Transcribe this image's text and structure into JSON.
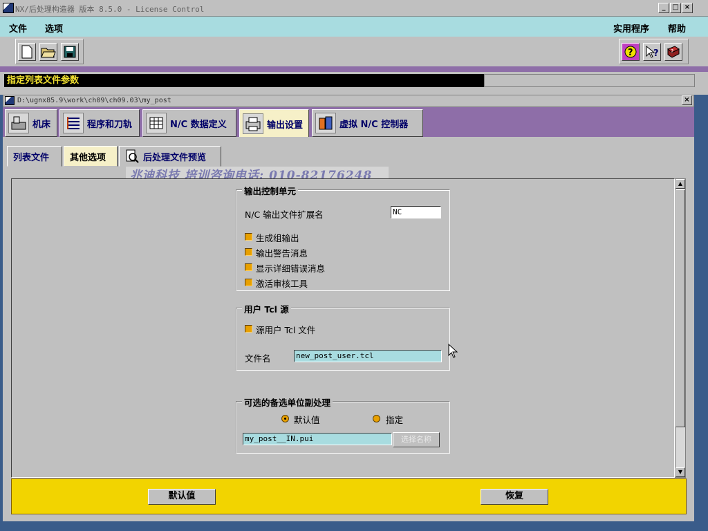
{
  "window": {
    "title": "NX/后处理构造器 版本 8.5.0 - License Control",
    "min": "_",
    "max": "□",
    "close": "×"
  },
  "menubar": {
    "file": "文件",
    "options": "选项",
    "utilities": "实用程序",
    "help": "帮助"
  },
  "status": {
    "message": "指定列表文件参数"
  },
  "subwindow": {
    "path": "D:\\ugnx85.9\\work\\ch09\\ch09.03\\my_post",
    "close": "×"
  },
  "main_tabs": [
    {
      "label": "机床"
    },
    {
      "label": "程序和刀轨"
    },
    {
      "label": "N/C 数据定义"
    },
    {
      "label": "输出设置",
      "active": true
    },
    {
      "label": "虚拟 N/C 控制器"
    }
  ],
  "sub_tabs": [
    {
      "label": "列表文件"
    },
    {
      "label": "其他选项",
      "active": true
    },
    {
      "label": "后处理文件预览"
    }
  ],
  "watermark": "兆迪科技 培训咨询电话: 010-82176248",
  "output_control": {
    "title": "输出控制单元",
    "ext_label": "N/C 输出文件扩展名",
    "ext_value": "NC",
    "options": [
      "生成组输出",
      "输出警告消息",
      "显示详细错误消息",
      "激活审核工具"
    ]
  },
  "user_tcl": {
    "title": "用户 Tcl 源",
    "source_label": "源用户 Tcl 文件",
    "filename_label": "文件名",
    "filename_value": "new_post_user.tcl"
  },
  "alt_unit": {
    "title": "可选的备选单位副处理",
    "radio_default": "默认值",
    "radio_specify": "指定",
    "radio_selected": "默认值",
    "file_value": "my_post__IN.pui",
    "select_button": "选择名称"
  },
  "footer": {
    "default_button": "默认值",
    "restore_button": "恢复"
  },
  "colors": {
    "menubar": "#a8dce0",
    "purple": "#8e6ea8",
    "footer": "#f2d400",
    "status_text": "#f0e030",
    "checkbox": "#e8a000"
  }
}
